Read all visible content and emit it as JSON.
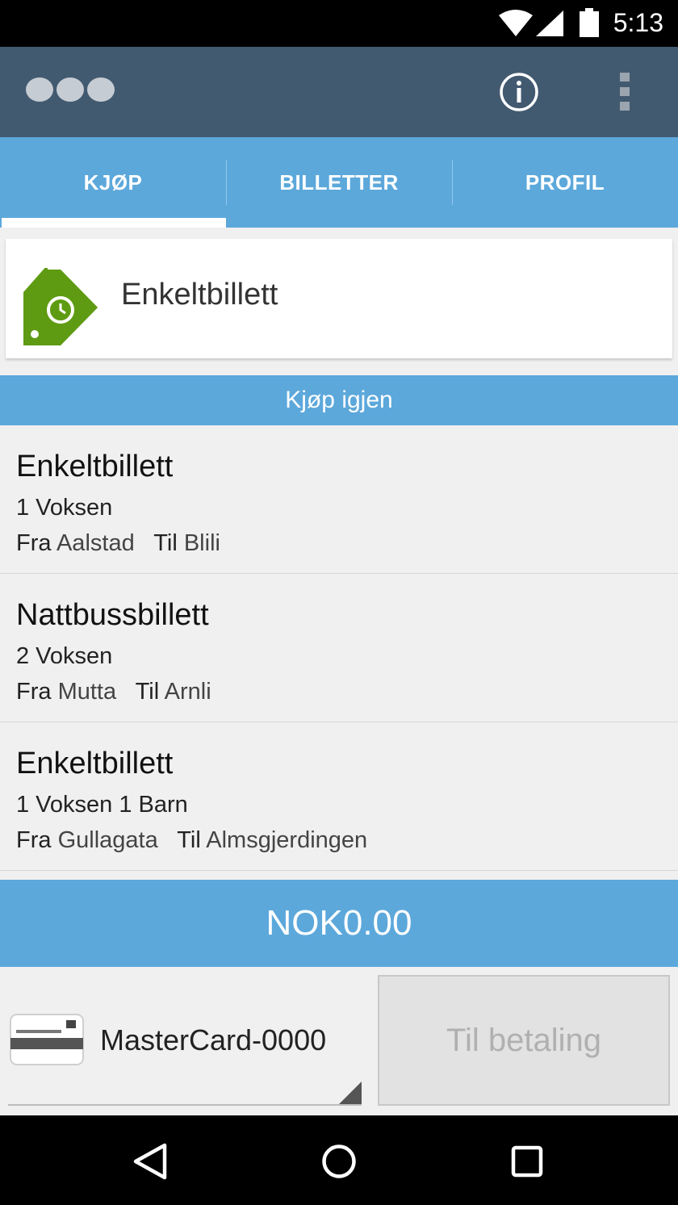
{
  "status_bar": {
    "time": "5:13",
    "icons": [
      "wifi-icon",
      "signal-icon",
      "battery-icon"
    ]
  },
  "app_bar": {
    "icons": [
      "app-logo",
      "info-icon",
      "more-vert-icon"
    ],
    "color": "#425a70"
  },
  "tabs": [
    {
      "label": "KJØP",
      "active": true
    },
    {
      "label": "BILLETTER",
      "active": false
    },
    {
      "label": "PROFIL",
      "active": false
    }
  ],
  "ticket_type": {
    "label": "Enkeltbillett",
    "icon": "ticket-tag-icon",
    "icon_color": "#5e9b12"
  },
  "rebuy": {
    "header": "Kjøp igjen",
    "from_label": "Fra",
    "to_label": "Til",
    "items": [
      {
        "title": "Enkeltbillett",
        "passengers": "1 Voksen",
        "from": "Aalstad",
        "to": "Blili"
      },
      {
        "title": "Nattbussbillett",
        "passengers": "2 Voksen",
        "from": "Mutta",
        "to": "Arnli"
      },
      {
        "title": "Enkeltbillett",
        "passengers": "1 Voksen 1 Barn",
        "from": "Gullagata",
        "to": "Almsgjerdingen"
      }
    ]
  },
  "total": {
    "amount": "NOK0.00"
  },
  "payment": {
    "card_label": "MasterCard-0000",
    "card_icon": "credit-card-icon",
    "pay_button": "Til betaling"
  },
  "accent_color": "#5ca8db",
  "nav_bar": {
    "icons": [
      "back-icon",
      "home-icon",
      "recent-apps-icon"
    ]
  }
}
